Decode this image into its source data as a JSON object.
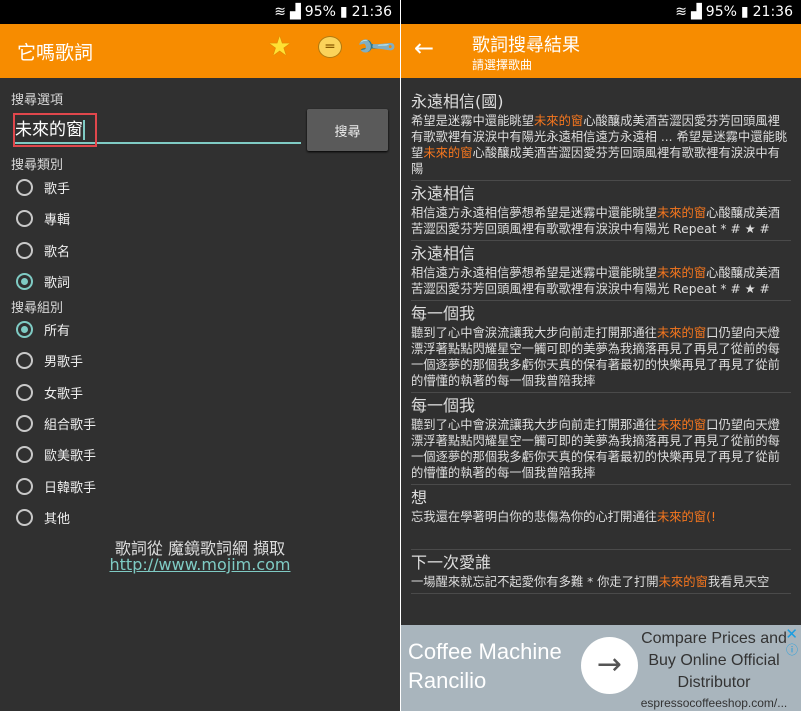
{
  "status": {
    "battery": "95%",
    "time": "21:36"
  },
  "left": {
    "title": "它嗎歌詞",
    "search_options_label": "搜尋選項",
    "search_value": "未來的窗",
    "search_button": "搜尋",
    "category_label": "搜尋類別",
    "categories": [
      {
        "label": "歌手",
        "selected": false
      },
      {
        "label": "專輯",
        "selected": false
      },
      {
        "label": "歌名",
        "selected": false
      },
      {
        "label": "歌詞",
        "selected": true
      }
    ],
    "group_label": "搜尋組別",
    "groups": [
      {
        "label": "所有",
        "selected": true
      },
      {
        "label": "男歌手"
      },
      {
        "label": "女歌手"
      },
      {
        "label": "組合歌手"
      },
      {
        "label": "歐美歌手"
      },
      {
        "label": "日韓歌手"
      },
      {
        "label": "其他"
      }
    ],
    "credit": "歌詞從 魔鏡歌詞網 擷取",
    "credit_link": "http://www.mojim.com"
  },
  "right": {
    "title": "歌詞搜尋結果",
    "subtitle": "請選擇歌曲",
    "results": [
      {
        "title": "永遠相信(國)",
        "parts": [
          "希望是迷霧中還能眺望",
          "未來的窗",
          "心酸釀成美酒苦澀因愛芬芳回頭風裡有歌歌裡有淚淚中有陽光永遠相信遠方永遠相 ... 希望是迷霧中還能眺望",
          "未來的窗",
          "心酸釀成美酒苦澀因愛芬芳回頭風裡有歌歌裡有淚淚中有陽"
        ]
      },
      {
        "title": "永遠相信",
        "parts": [
          "相信遠方永遠相信夢想希望是迷霧中還能眺望",
          "未來的窗",
          "心酸釀成美酒苦澀因愛芬芳回頭風裡有歌歌裡有淚淚中有陽光 Repeat * # ★ #"
        ]
      },
      {
        "title": "永遠相信",
        "parts": [
          "相信遠方永遠相信夢想希望是迷霧中還能眺望",
          "未來的窗",
          "心酸釀成美酒苦澀因愛芬芳回頭風裡有歌歌裡有淚淚中有陽光 Repeat * # ★ #"
        ]
      },
      {
        "title": "每一個我",
        "parts": [
          "聽到了心中會淚流讓我大步向前走打開那通往",
          "未來的窗",
          "口仍望向天燈漂浮著點點閃耀星空一觸可即的美夢為我摘落再見了再見了從前的每一個逐夢的那個我多虧你天真的保有著最初的快樂再見了再見了從前的懵懂的執著的每一個我曾陪我摔"
        ]
      },
      {
        "title": "每一個我",
        "parts": [
          "聽到了心中會淚流讓我大步向前走打開那通往",
          "未來的窗",
          "口仍望向天燈漂浮著點點閃耀星空一觸可即的美夢為我摘落再見了再見了從前的每一個逐夢的那個我多虧你天真的保有著最初的快樂再見了再見了從前的懵懂的執著的每一個我曾陪我摔"
        ]
      },
      {
        "title": "想",
        "parts": [
          "忘我還在學著明白你的悲傷為你的心打開通往",
          "未來的窗(!",
          ""
        ]
      },
      {
        "title": "下一次愛誰",
        "parts": [
          "一場醒來就忘記不起愛你有多難 * 你走了打開",
          "未來的窗",
          "我看見天空"
        ]
      }
    ]
  },
  "ad": {
    "headline": "Coffee Machine Rancilio",
    "body": "Compare Prices and Buy Online Official Distributor",
    "url": "espressocoffeeshop.com/...",
    "colors": {
      "bg": "#a9b5bd"
    }
  },
  "colors": {
    "appbar": "#f78c00",
    "background": "#303030",
    "accent": "#7fcbc4",
    "highlight": "#f5761e"
  }
}
